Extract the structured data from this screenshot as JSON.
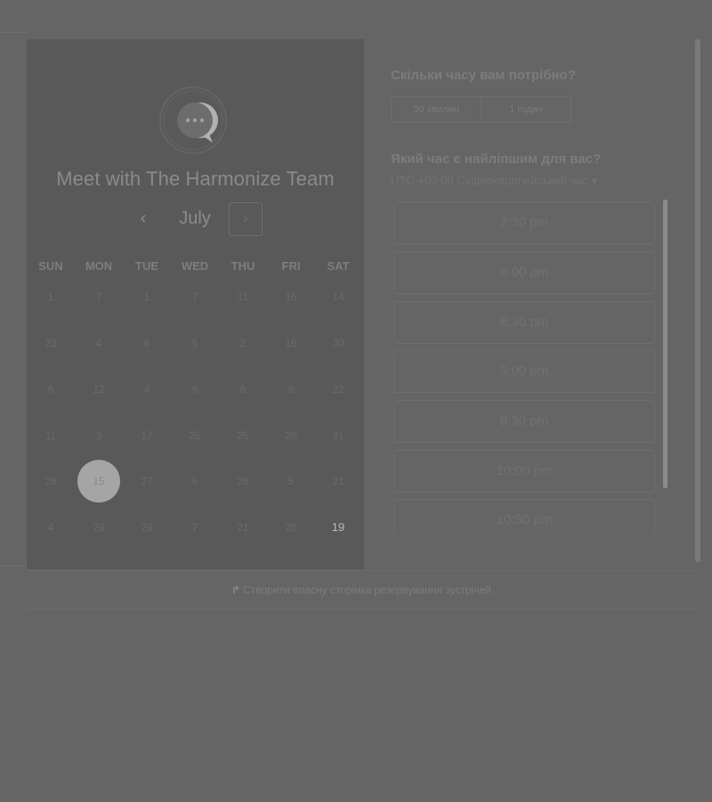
{
  "booking": {
    "organizer": "Meet with The Harmonize Team",
    "month": "July",
    "weekdays": [
      "SUN",
      "MON",
      "TUE",
      "WED",
      "THU",
      "FRI",
      "SAT"
    ],
    "calendar_rows": [
      [
        "1",
        "7",
        "1",
        "7",
        "11",
        "16",
        "14"
      ],
      [
        "23",
        "4",
        "6",
        "5",
        "2",
        "16",
        "30"
      ],
      [
        "6",
        "12",
        "4",
        "9",
        "8",
        "9",
        "22"
      ],
      [
        "11",
        "3",
        "17",
        "25",
        "25",
        "20",
        "31"
      ],
      [
        "28",
        "15",
        "27",
        "6",
        "26",
        "5",
        "21"
      ],
      [
        "4",
        "29",
        "29",
        "7",
        "21",
        "20",
        "19"
      ]
    ],
    "selected_day": "15",
    "highlighted_day": "19"
  },
  "duration": {
    "title": "Скільки часу вам потрібно?",
    "options": [
      "30 хвилин",
      "1 годин"
    ]
  },
  "time": {
    "title": "Який час є найліпшим для вас?",
    "timezone": "UTC +03:00 Східноєвропейський час ▾",
    "slots": [
      "7:30 pm",
      "8:00 pm",
      "8:30 pm",
      "9:00 pm",
      "9:30 pm",
      "10:00 pm",
      "10:30 pm"
    ]
  },
  "footer": {
    "link_text": "Створити власну сторінка резервування зустрічей"
  },
  "icons": {
    "logo": "chat-bubble-logo-icon",
    "prev": "chevron-left-icon",
    "next": "chevron-right-icon",
    "brand": "bookings-brand-icon"
  }
}
